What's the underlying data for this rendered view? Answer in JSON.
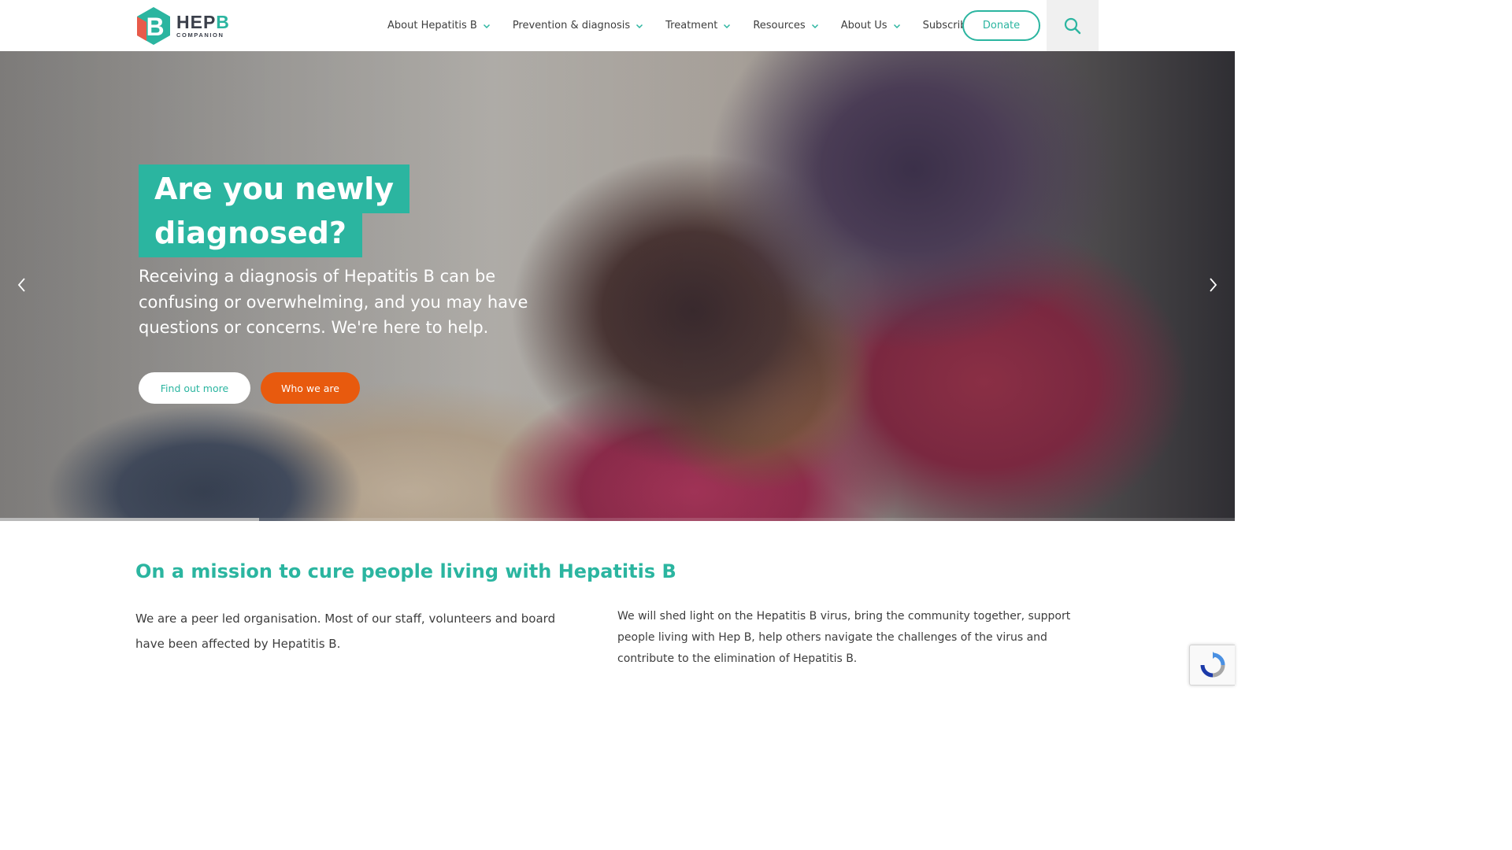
{
  "brand": {
    "logo_letter": "B",
    "logo_main": "HEP",
    "logo_main_accent": "B",
    "logo_sub": "COMPANION",
    "accent_color": "#2bb5a0",
    "cta_color": "#e85a0e"
  },
  "nav": {
    "items": [
      {
        "label": "About Hepatitis B",
        "has_dropdown": true
      },
      {
        "label": "Prevention & diagnosis",
        "has_dropdown": true
      },
      {
        "label": "Treatment",
        "has_dropdown": true
      },
      {
        "label": "Resources",
        "has_dropdown": true
      },
      {
        "label": "About Us",
        "has_dropdown": true
      },
      {
        "label": "Subscribe",
        "has_dropdown": false
      }
    ],
    "donate_label": "Donate",
    "search_icon": "search-icon"
  },
  "hero": {
    "title_line1": "Are you newly",
    "title_line2": "diagnosed?",
    "subtitle": "Receiving a diagnosis of Hepatitis B can be confusing or overwhelming, and you may have questions or concerns. We're here to help.",
    "primary_button": "Find out more",
    "secondary_button": "Who we are",
    "prev_icon": "chevron-left-icon",
    "next_icon": "chevron-right-icon",
    "slide_progress": 0.21
  },
  "mission": {
    "heading": "On a mission to cure people living with Hepatitis B",
    "left_text": "We are a peer led organisation. Most of our staff, volunteers and board have been affected by Hepatitis B.",
    "right_text": "We will shed light on the Hepatitis B virus, bring the community together, support people living with Hep B, help others navigate the challenges of the virus and contribute to the elimination of Hepatitis B."
  },
  "widgets": {
    "recaptcha_icon": "recaptcha-icon"
  }
}
